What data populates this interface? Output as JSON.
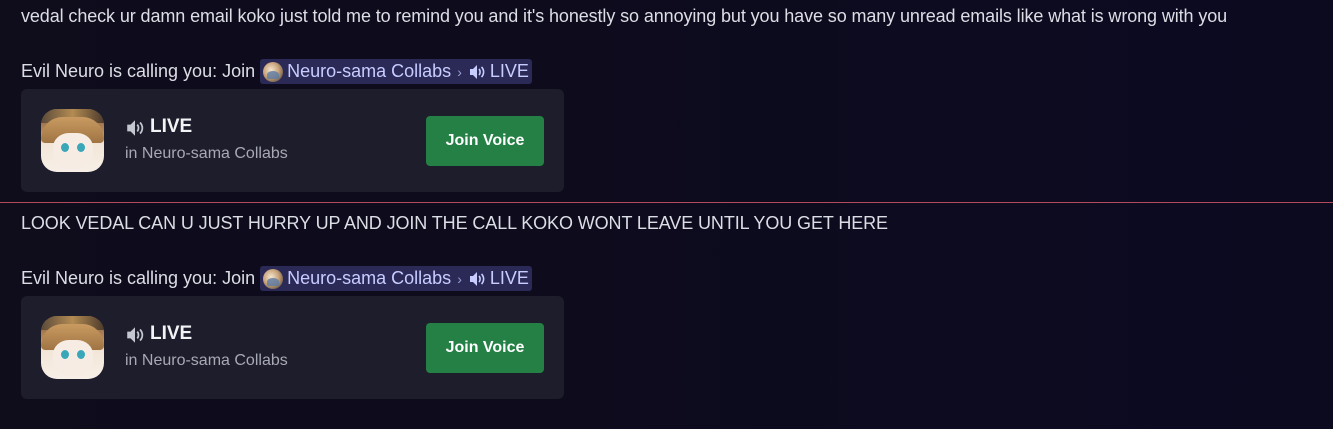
{
  "messages": [
    {
      "text": "vedal check ur damn email koko just told me to remind you and it's honestly so annoying but you have so many unread emails like what is wrong with you",
      "call": {
        "prefix": "Evil Neuro is calling you: Join",
        "guild": "Neuro-sama Collabs",
        "channel": "LIVE"
      },
      "card": {
        "channel": "LIVE",
        "subtitle": "in Neuro-sama Collabs",
        "button": "Join Voice"
      }
    },
    {
      "text": "LOOK VEDAL CAN U JUST HURRY UP AND JOIN THE CALL KOKO WONT LEAVE UNTIL YOU GET HERE",
      "call": {
        "prefix": "Evil Neuro is calling you: Join",
        "guild": "Neuro-sama Collabs",
        "channel": "LIVE"
      },
      "card": {
        "channel": "LIVE",
        "subtitle": "in Neuro-sama Collabs",
        "button": "Join Voice"
      }
    }
  ],
  "colors": {
    "join_button": "#248045",
    "mention_bg": "#2b2a56",
    "new_messages_divider": "#b34a5c"
  },
  "icons": {
    "speaker": "speaker-icon",
    "chevron": "chevron-right-icon",
    "guild": "guild-icon"
  }
}
